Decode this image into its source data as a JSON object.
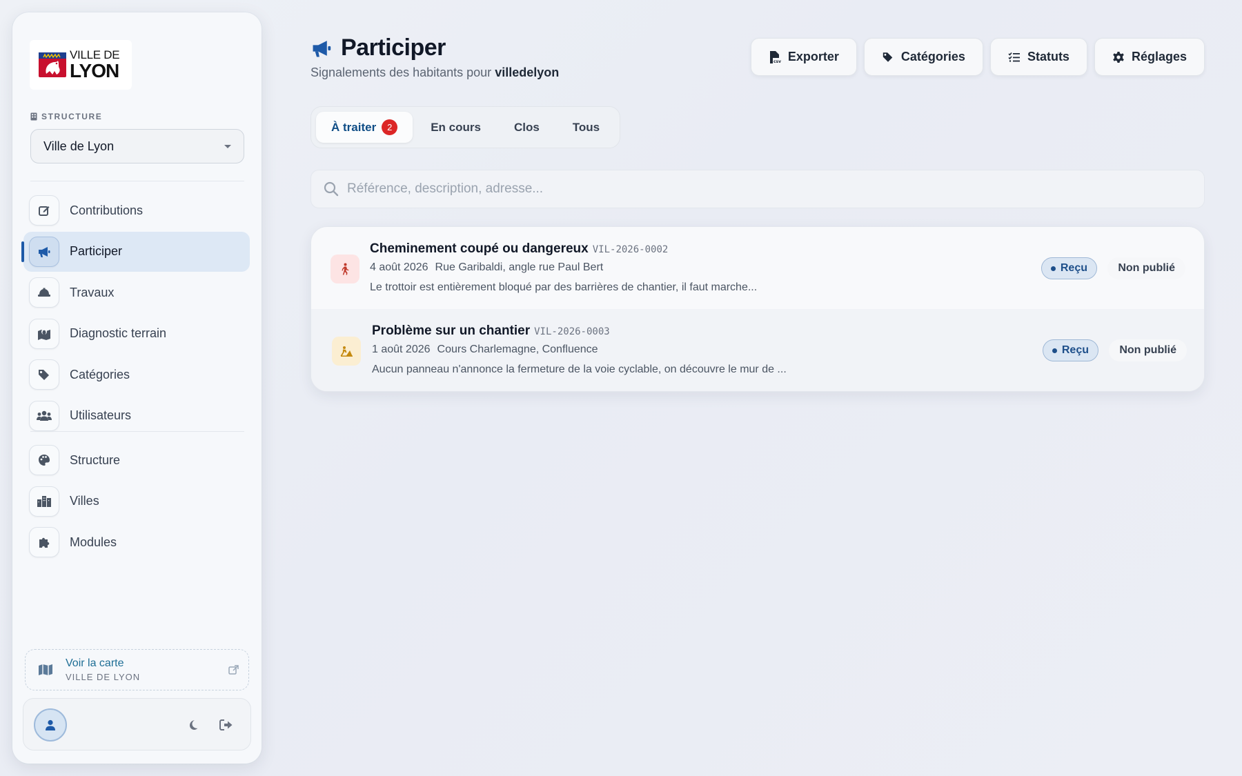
{
  "sidebar": {
    "logo": {
      "line1": "VILLE DE",
      "line2": "LYON"
    },
    "structure_label": "STRUCTURE",
    "structure_select": {
      "value": "Ville de Lyon"
    },
    "nav": [
      {
        "label": "Contributions",
        "icon": "edit-icon"
      },
      {
        "label": "Participer",
        "icon": "megaphone-icon",
        "active": true
      },
      {
        "label": "Travaux",
        "icon": "hardhat-icon"
      },
      {
        "label": "Diagnostic terrain",
        "icon": "map-pin-icon"
      },
      {
        "label": "Catégories",
        "icon": "tags-icon"
      },
      {
        "label": "Utilisateurs",
        "icon": "users-icon"
      },
      {
        "label": "Structure",
        "icon": "palette-icon"
      },
      {
        "label": "Villes",
        "icon": "city-icon"
      },
      {
        "label": "Modules",
        "icon": "puzzle-icon"
      }
    ],
    "map_link": {
      "title": "Voir la carte",
      "subtitle": "VILLE DE LYON"
    }
  },
  "header": {
    "title": "Participer",
    "subtitle_prefix": "Signalements des habitants pour",
    "subtitle_org": "villedelyon",
    "actions": [
      {
        "label": "Exporter",
        "icon": "file-csv-icon"
      },
      {
        "label": "Catégories",
        "icon": "tags-icon"
      },
      {
        "label": "Statuts",
        "icon": "list-check-icon"
      },
      {
        "label": "Réglages",
        "icon": "gear-icon"
      }
    ]
  },
  "tabs": [
    {
      "label": "À traiter",
      "badge": "2",
      "active": true
    },
    {
      "label": "En cours"
    },
    {
      "label": "Clos"
    },
    {
      "label": "Tous"
    }
  ],
  "search": {
    "placeholder": "Référence, description, adresse...",
    "value": ""
  },
  "reports": [
    {
      "title": "Cheminement coupé ou dangereux",
      "ref": "VIL-2026-0002",
      "date": "4 août 2026",
      "address": "Rue Garibaldi, angle rue Paul Bert",
      "description": "Le trottoir est entièrement bloqué par des barrières de chantier, il faut marche...",
      "status": "Reçu",
      "publication": "Non publié",
      "icon": "pedestrian-icon",
      "icon_color": "#c0392b"
    },
    {
      "title": "Problème sur un chantier",
      "ref": "VIL-2026-0003",
      "date": "1 août 2026",
      "address": "Cours Charlemagne, Confluence",
      "description": "Aucun panneau n'annonce la fermeture de la voie cyclable, on découvre le mur de ...",
      "status": "Reçu",
      "publication": "Non publié",
      "icon": "construction-worker-icon",
      "icon_color": "#c58a10"
    }
  ],
  "colors": {
    "accent": "#1e5aa8",
    "badge": "#dc2626",
    "status_pill": "#dbe6f3"
  }
}
